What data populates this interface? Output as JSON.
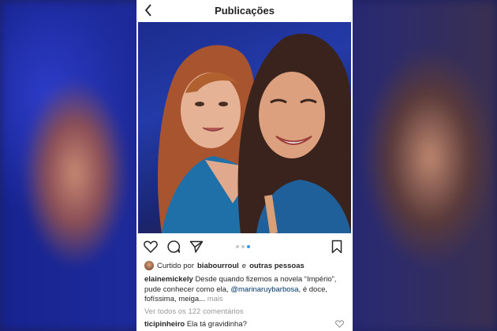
{
  "header": {
    "title": "Publicações",
    "back_icon": "chevron-left-icon"
  },
  "post": {
    "photo_description_icon": "photo",
    "actions": {
      "like_icon": "heart-icon",
      "comment_icon": "comment-icon",
      "share_icon": "send-icon",
      "save_icon": "bookmark-icon"
    },
    "carousel": {
      "count": 3,
      "active_index": 2
    },
    "likes": {
      "prefix": "Curtido por",
      "user": "biabourroul",
      "joiner": "e",
      "others": "outras pessoas"
    },
    "caption": {
      "username": "elainemickely",
      "text_1": "Desde quando fizemos a novela “Império”, pude conhecer como ela,",
      "mention": "@marinaruybarbosa",
      "text_2": ", é doce, fofíssima, meiga...",
      "more": "mais"
    },
    "comments_link": "Ver todos os 122 comentários",
    "top_comment": {
      "username": "ticipinheiro",
      "text": "Ela tá gravidinha?"
    }
  },
  "colors": {
    "link_blue": "#003569",
    "active_dot": "#3897f0",
    "muted": "#999999"
  }
}
